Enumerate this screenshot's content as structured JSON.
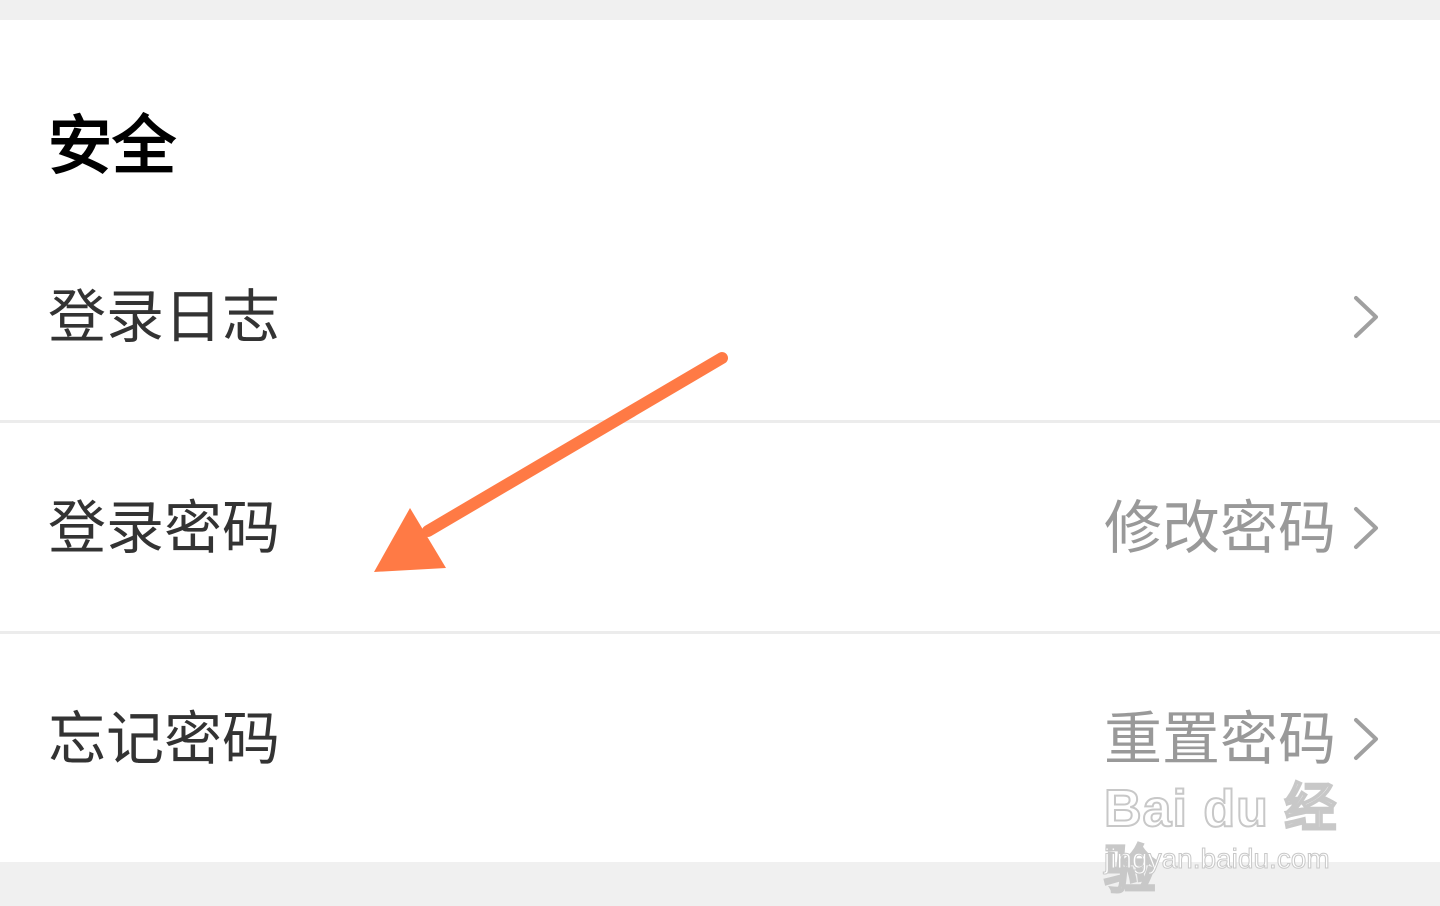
{
  "section": {
    "title": "安全"
  },
  "rows": [
    {
      "label": "登录日志",
      "value": "",
      "chevron_icon": "chevron-right-icon"
    },
    {
      "label": "登录密码",
      "value": "修改密码",
      "chevron_icon": "chevron-right-icon"
    },
    {
      "label": "忘记密码",
      "value": "重置密码",
      "chevron_icon": "chevron-right-icon"
    }
  ],
  "annotation": {
    "icon": "arrow-pointer-icon",
    "color": "#ff7a45"
  },
  "watermark": {
    "brand": "Bai du 经验",
    "url": "jingyan.baidu.com"
  },
  "colors": {
    "background": "#f0f0f0",
    "card": "#ffffff",
    "title_text": "#000000",
    "label_text": "#333333",
    "value_text": "#999999",
    "divider": "#ececec",
    "chevron": "#a0a0a0"
  }
}
